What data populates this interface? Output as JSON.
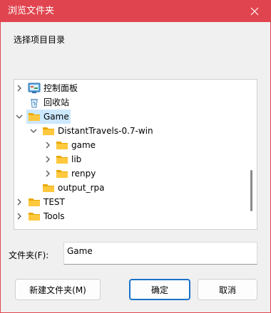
{
  "window": {
    "title": "浏览文件夹",
    "accent": "#e0454f"
  },
  "prompt": "选择项目目录",
  "tree": {
    "items": [
      {
        "label": "控制面板",
        "icon": "control-panel-icon",
        "expander": "collapsed",
        "selected": false
      },
      {
        "label": "回收站",
        "icon": "recycle-bin-icon",
        "expander": "none",
        "selected": false
      },
      {
        "label": "Game",
        "icon": "folder-icon",
        "expander": "expanded",
        "selected": true
      },
      {
        "label": "DistantTravels-0.7-win",
        "icon": "folder-icon",
        "expander": "expanded",
        "selected": false
      },
      {
        "label": "game",
        "icon": "folder-icon",
        "expander": "collapsed",
        "selected": false
      },
      {
        "label": "lib",
        "icon": "folder-icon",
        "expander": "collapsed",
        "selected": false
      },
      {
        "label": "renpy",
        "icon": "folder-icon",
        "expander": "collapsed",
        "selected": false
      },
      {
        "label": "output_rpa",
        "icon": "folder-icon",
        "expander": "none",
        "selected": false
      },
      {
        "label": "TEST",
        "icon": "folder-icon",
        "expander": "collapsed",
        "selected": false
      },
      {
        "label": "Tools",
        "icon": "folder-icon",
        "expander": "collapsed",
        "selected": false
      }
    ],
    "selection_color": "#cce8ff"
  },
  "folder": {
    "label": "文件夹(F):",
    "value": "Game"
  },
  "buttons": {
    "new_folder": "新建文件夹(M)",
    "ok": "确定",
    "cancel": "取消"
  }
}
